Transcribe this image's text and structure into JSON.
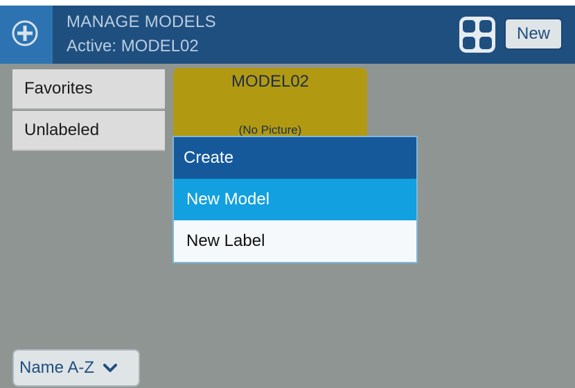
{
  "header": {
    "title": "MANAGE MODELS",
    "subtitle": "Active: MODEL02",
    "new_button": "New",
    "left_icon": "plus-circle-icon",
    "grid_icon": "grid-view-icon"
  },
  "labels": [
    {
      "label": "Favorites"
    },
    {
      "label": "Unlabeled"
    }
  ],
  "model_card": {
    "name": "MODEL02",
    "picture_text": "(No Picture)"
  },
  "create_menu": {
    "title": "Create",
    "items": [
      {
        "label": "New Model",
        "selected": true
      },
      {
        "label": "New Label",
        "selected": false
      }
    ]
  },
  "sort": {
    "value": "Name A-Z",
    "icon": "chevron-down-icon"
  },
  "colors": {
    "header_bg": "#1f4f7f",
    "accent": "#12a0e0",
    "menu_title_bg": "#15599b",
    "card_bg": "#b19a12",
    "background": "#8f9592"
  }
}
